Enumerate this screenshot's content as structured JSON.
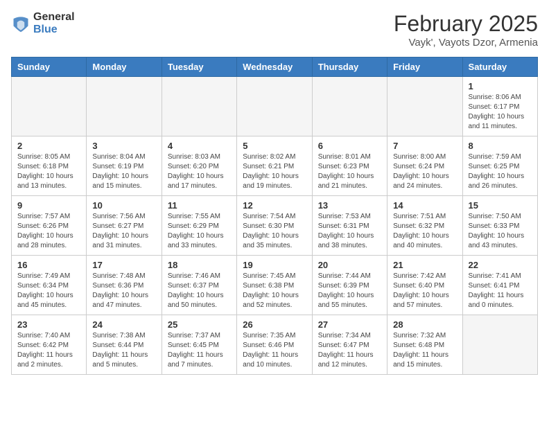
{
  "header": {
    "logo_general": "General",
    "logo_blue": "Blue",
    "title": "February 2025",
    "subtitle": "Vayk', Vayots Dzor, Armenia"
  },
  "weekdays": [
    "Sunday",
    "Monday",
    "Tuesday",
    "Wednesday",
    "Thursday",
    "Friday",
    "Saturday"
  ],
  "weeks": [
    [
      {
        "day": "",
        "info": ""
      },
      {
        "day": "",
        "info": ""
      },
      {
        "day": "",
        "info": ""
      },
      {
        "day": "",
        "info": ""
      },
      {
        "day": "",
        "info": ""
      },
      {
        "day": "",
        "info": ""
      },
      {
        "day": "1",
        "info": "Sunrise: 8:06 AM\nSunset: 6:17 PM\nDaylight: 10 hours\nand 11 minutes."
      }
    ],
    [
      {
        "day": "2",
        "info": "Sunrise: 8:05 AM\nSunset: 6:18 PM\nDaylight: 10 hours\nand 13 minutes."
      },
      {
        "day": "3",
        "info": "Sunrise: 8:04 AM\nSunset: 6:19 PM\nDaylight: 10 hours\nand 15 minutes."
      },
      {
        "day": "4",
        "info": "Sunrise: 8:03 AM\nSunset: 6:20 PM\nDaylight: 10 hours\nand 17 minutes."
      },
      {
        "day": "5",
        "info": "Sunrise: 8:02 AM\nSunset: 6:21 PM\nDaylight: 10 hours\nand 19 minutes."
      },
      {
        "day": "6",
        "info": "Sunrise: 8:01 AM\nSunset: 6:23 PM\nDaylight: 10 hours\nand 21 minutes."
      },
      {
        "day": "7",
        "info": "Sunrise: 8:00 AM\nSunset: 6:24 PM\nDaylight: 10 hours\nand 24 minutes."
      },
      {
        "day": "8",
        "info": "Sunrise: 7:59 AM\nSunset: 6:25 PM\nDaylight: 10 hours\nand 26 minutes."
      }
    ],
    [
      {
        "day": "9",
        "info": "Sunrise: 7:57 AM\nSunset: 6:26 PM\nDaylight: 10 hours\nand 28 minutes."
      },
      {
        "day": "10",
        "info": "Sunrise: 7:56 AM\nSunset: 6:27 PM\nDaylight: 10 hours\nand 31 minutes."
      },
      {
        "day": "11",
        "info": "Sunrise: 7:55 AM\nSunset: 6:29 PM\nDaylight: 10 hours\nand 33 minutes."
      },
      {
        "day": "12",
        "info": "Sunrise: 7:54 AM\nSunset: 6:30 PM\nDaylight: 10 hours\nand 35 minutes."
      },
      {
        "day": "13",
        "info": "Sunrise: 7:53 AM\nSunset: 6:31 PM\nDaylight: 10 hours\nand 38 minutes."
      },
      {
        "day": "14",
        "info": "Sunrise: 7:51 AM\nSunset: 6:32 PM\nDaylight: 10 hours\nand 40 minutes."
      },
      {
        "day": "15",
        "info": "Sunrise: 7:50 AM\nSunset: 6:33 PM\nDaylight: 10 hours\nand 43 minutes."
      }
    ],
    [
      {
        "day": "16",
        "info": "Sunrise: 7:49 AM\nSunset: 6:34 PM\nDaylight: 10 hours\nand 45 minutes."
      },
      {
        "day": "17",
        "info": "Sunrise: 7:48 AM\nSunset: 6:36 PM\nDaylight: 10 hours\nand 47 minutes."
      },
      {
        "day": "18",
        "info": "Sunrise: 7:46 AM\nSunset: 6:37 PM\nDaylight: 10 hours\nand 50 minutes."
      },
      {
        "day": "19",
        "info": "Sunrise: 7:45 AM\nSunset: 6:38 PM\nDaylight: 10 hours\nand 52 minutes."
      },
      {
        "day": "20",
        "info": "Sunrise: 7:44 AM\nSunset: 6:39 PM\nDaylight: 10 hours\nand 55 minutes."
      },
      {
        "day": "21",
        "info": "Sunrise: 7:42 AM\nSunset: 6:40 PM\nDaylight: 10 hours\nand 57 minutes."
      },
      {
        "day": "22",
        "info": "Sunrise: 7:41 AM\nSunset: 6:41 PM\nDaylight: 11 hours\nand 0 minutes."
      }
    ],
    [
      {
        "day": "23",
        "info": "Sunrise: 7:40 AM\nSunset: 6:42 PM\nDaylight: 11 hours\nand 2 minutes."
      },
      {
        "day": "24",
        "info": "Sunrise: 7:38 AM\nSunset: 6:44 PM\nDaylight: 11 hours\nand 5 minutes."
      },
      {
        "day": "25",
        "info": "Sunrise: 7:37 AM\nSunset: 6:45 PM\nDaylight: 11 hours\nand 7 minutes."
      },
      {
        "day": "26",
        "info": "Sunrise: 7:35 AM\nSunset: 6:46 PM\nDaylight: 11 hours\nand 10 minutes."
      },
      {
        "day": "27",
        "info": "Sunrise: 7:34 AM\nSunset: 6:47 PM\nDaylight: 11 hours\nand 12 minutes."
      },
      {
        "day": "28",
        "info": "Sunrise: 7:32 AM\nSunset: 6:48 PM\nDaylight: 11 hours\nand 15 minutes."
      },
      {
        "day": "",
        "info": ""
      }
    ]
  ]
}
